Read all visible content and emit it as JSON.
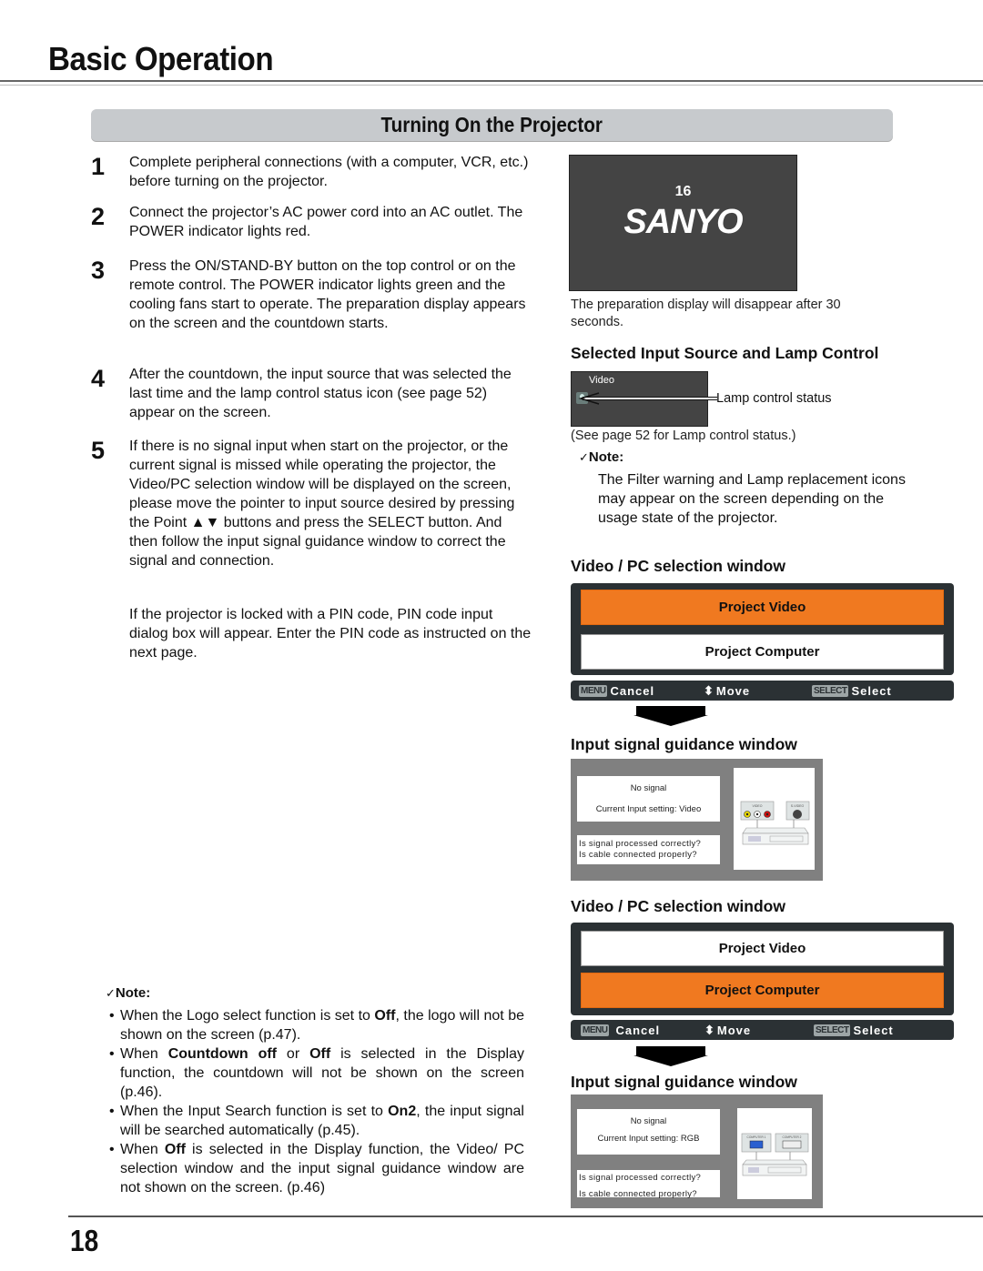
{
  "header": {
    "title": "Basic Operation"
  },
  "section": {
    "title": "Turning On the Projector"
  },
  "steps": [
    {
      "num": "1",
      "text": "Complete peripheral connections (with a computer, VCR, etc.) before turning on the projector."
    },
    {
      "num": "2",
      "text": "Connect the projector’s AC power cord into an AC outlet. The POWER indicator lights red."
    },
    {
      "num": "3",
      "text": "Press the ON/STAND-BY button on the top control or  on the remote control. The POWER indicator lights green and the cooling fans start to operate. The preparation display appears on the screen and the countdown starts."
    },
    {
      "num": "4",
      "text": "After the countdown, the input source that was selected the last time and the lamp control status icon (see page 52) appear on the screen."
    },
    {
      "num": "5",
      "text": "If there is no signal input when start on the projector, or the current signal is missed while operating the projector, the Video/PC selection window will be displayed on the screen, please move the pointer to input source desired by pressing the Point ▲▼ buttons and press the SELECT button. And then follow the input signal guidance window to correct the signal and connection."
    }
  ],
  "pin_paragraph": "If the projector is locked with a PIN code, PIN code input dialog box will appear. Enter the PIN code as instructed on the next page.",
  "notes_left": {
    "heading": "Note:",
    "check_glyph": "✓",
    "items": [
      {
        "parts": [
          {
            "t": "When the Logo select function is set to "
          },
          {
            "t": "Off",
            "b": true
          },
          {
            "t": ", the logo will not be shown on the screen (p.47)."
          }
        ]
      },
      {
        "parts": [
          {
            "t": "When "
          },
          {
            "t": "Countdown off",
            "b": true
          },
          {
            "t": " or "
          },
          {
            "t": "Off",
            "b": true
          },
          {
            "t": " is selected in the Display function, the countdown will not be shown on the screen (p.46)."
          }
        ]
      },
      {
        "parts": [
          {
            "t": "When the Input Search function is set to "
          },
          {
            "t": "On2",
            "b": true
          },
          {
            "t": ", the input signal will be searched automatically (p.45)."
          }
        ]
      },
      {
        "parts": [
          {
            "t": "When "
          },
          {
            "t": "Off",
            "b": true
          },
          {
            "t": " is selected in the Display function, the Video/ PC selection window and the input signal guidance window are not shown on the screen. (p.46)"
          }
        ]
      }
    ]
  },
  "prep_display": {
    "countdown": "16",
    "logo": "SANYO",
    "caption": "The preparation display will disappear after 30 seconds."
  },
  "lamp_section": {
    "heading": "Selected Input Source and Lamp Control",
    "source_label": "Video",
    "lamp_label": "Lamp control status",
    "caption": "(See page 52 for Lamp control status.)"
  },
  "notes_right": {
    "heading": "Note:",
    "check_glyph": "✓",
    "text": "The Filter warning and Lamp replacement icons may appear on the screen depending on the usage state of the projector."
  },
  "selection_windows": [
    {
      "heading": "Video / PC selection window",
      "options": [
        "Project Video",
        "Project Computer"
      ],
      "selected_index": 0,
      "footer": {
        "menu_key": "MENU",
        "cancel": "Cancel",
        "move": "Move",
        "select_key": "SELECT",
        "select": "Select"
      }
    },
    {
      "heading": "Video / PC selection window",
      "options": [
        "Project Video",
        "Project Computer"
      ],
      "selected_index": 1,
      "footer": {
        "menu_key": "MENU",
        "cancel": "Cancel",
        "move": "Move",
        "select_key": "SELECT",
        "select": "Select"
      }
    }
  ],
  "guidance_windows": [
    {
      "heading": "Input signal guidance window",
      "status": "No signal",
      "current_input": "Current Input setting: Video",
      "questions": [
        "Is signal processed correctly?",
        "Is cable connected properly?"
      ],
      "ports": [
        "VIDEO",
        "S-VIDEO"
      ]
    },
    {
      "heading": "Input signal guidance window",
      "status": "No signal",
      "current_input": "Current Input setting: RGB",
      "questions": [
        "Is signal processed correctly?",
        "Is cable connected properly?"
      ],
      "ports": [
        "COMPUTER 1",
        "COMPUTER 2"
      ]
    }
  ],
  "colors": {
    "highlight_orange": "#f07920",
    "osd_dark": "#2b3134",
    "section_bar": "#c7cacd"
  },
  "footer": {
    "page_number": "18"
  }
}
